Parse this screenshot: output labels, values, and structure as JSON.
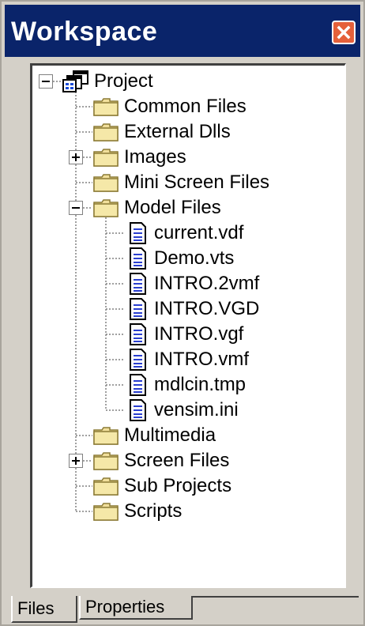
{
  "window": {
    "title": "Workspace",
    "close_icon": "close-icon",
    "colors": {
      "titlebar": "#0a246a",
      "close_button": "#e5603a",
      "frame": "#d4d0c8",
      "tree_background": "#ffffff"
    }
  },
  "tree": {
    "root": {
      "label": "Project",
      "icon": "project-icon",
      "expanded": true
    },
    "items": [
      {
        "label": "Common Files",
        "icon": "folder-icon",
        "expandable": false
      },
      {
        "label": "External Dlls",
        "icon": "folder-icon",
        "expandable": false
      },
      {
        "label": "Images",
        "icon": "folder-icon",
        "expandable": true,
        "expanded": false
      },
      {
        "label": "Mini Screen Files",
        "icon": "folder-icon",
        "expandable": false
      },
      {
        "label": "Model Files",
        "icon": "folder-icon",
        "expandable": true,
        "expanded": true,
        "children": [
          {
            "label": "current.vdf",
            "icon": "document-icon"
          },
          {
            "label": "Demo.vts",
            "icon": "document-icon"
          },
          {
            "label": "INTRO.2vmf",
            "icon": "document-icon"
          },
          {
            "label": "INTRO.VGD",
            "icon": "document-icon"
          },
          {
            "label": "INTRO.vgf",
            "icon": "document-icon"
          },
          {
            "label": "INTRO.vmf",
            "icon": "document-icon"
          },
          {
            "label": "mdlcin.tmp",
            "icon": "document-icon"
          },
          {
            "label": "vensim.ini",
            "icon": "document-icon"
          }
        ]
      },
      {
        "label": "Multimedia",
        "icon": "folder-icon",
        "expandable": false
      },
      {
        "label": "Screen Files",
        "icon": "folder-icon",
        "expandable": true,
        "expanded": false
      },
      {
        "label": "Sub Projects",
        "icon": "folder-icon",
        "expandable": false
      },
      {
        "label": "Scripts",
        "icon": "folder-icon",
        "expandable": false
      }
    ]
  },
  "tabs": [
    {
      "label": "Files",
      "selected": true
    },
    {
      "label": "Properties",
      "selected": false
    }
  ]
}
